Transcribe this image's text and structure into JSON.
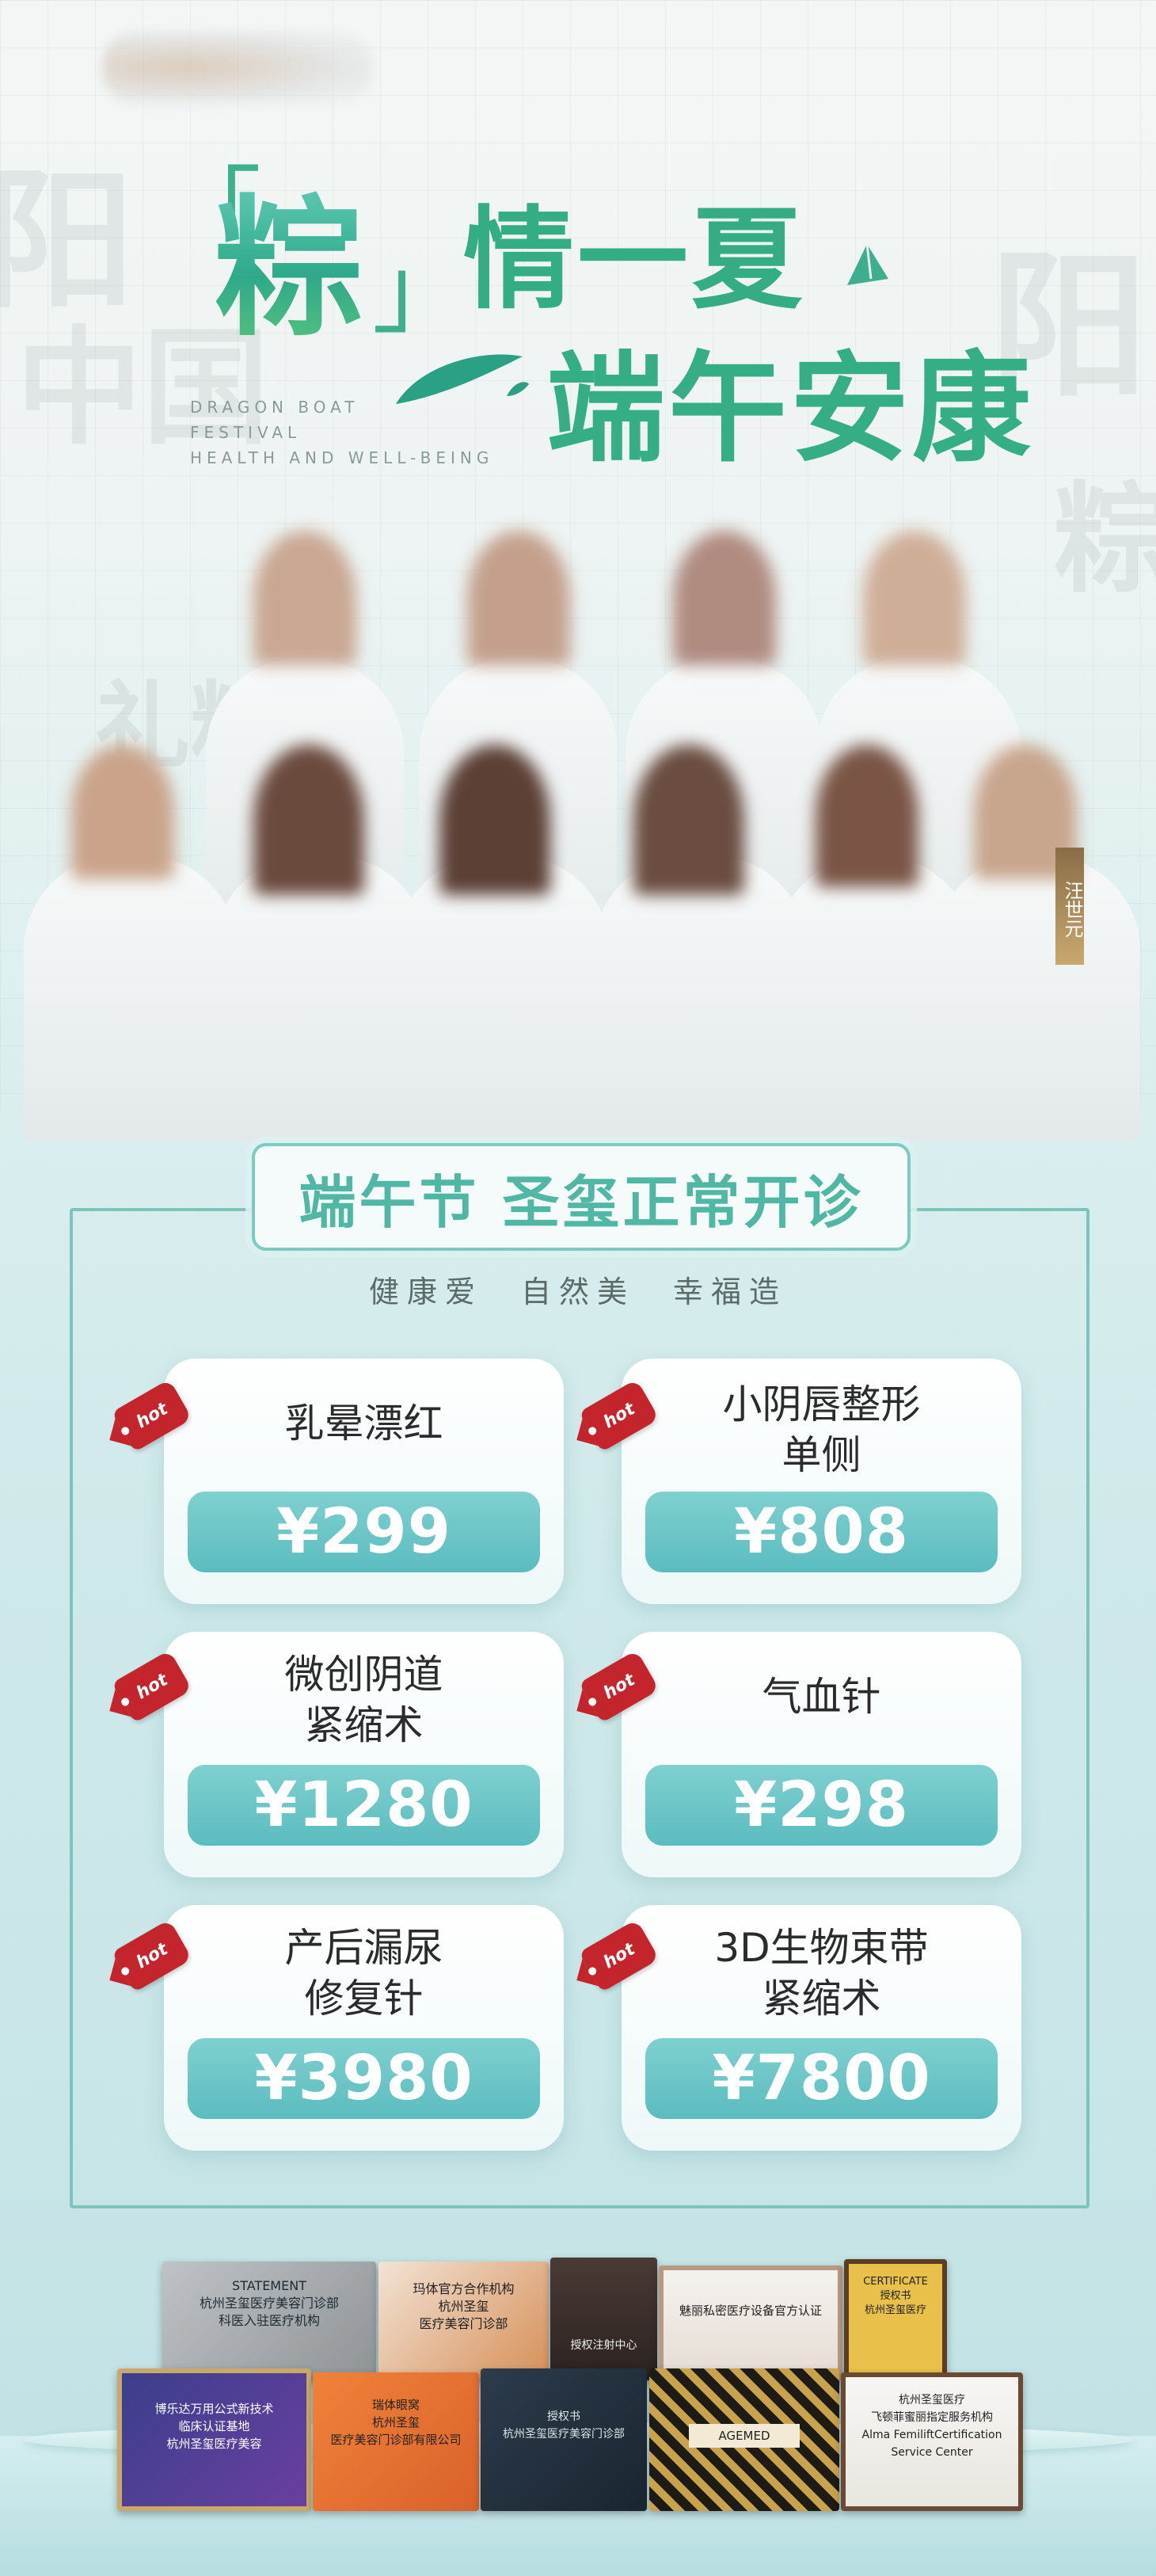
{
  "headline": {
    "bracket_left": "「",
    "zong": "粽",
    "bracket_right": "」",
    "line1_rest": "情一夏",
    "line2": "端午安康",
    "english": [
      "DRAGON BOAT",
      "FESTIVAL",
      "HEALTH AND WELL-BEING"
    ]
  },
  "team": {
    "name_plate": "汪世元"
  },
  "banner": {
    "text": "端午节 圣玺正常开诊"
  },
  "tagline": "健康爱　自然美　幸福造",
  "items": [
    {
      "name": "乳晕漂红",
      "price": "¥299",
      "badge": "hot"
    },
    {
      "name": "小阴唇整形\n单侧",
      "price": "¥808",
      "badge": "hot"
    },
    {
      "name": "微创阴道\n紧缩术",
      "price": "¥1280",
      "badge": "hot"
    },
    {
      "name": "气血针",
      "price": "¥298",
      "badge": "hot"
    },
    {
      "name": "产后漏尿\n修复针",
      "price": "¥3980",
      "badge": "hot"
    },
    {
      "name": "3D生物束带\n紧缩术",
      "price": "¥7800",
      "badge": "hot"
    }
  ],
  "certificates": [
    {
      "text": "STATEMENT\n杭州圣玺医疗美容门诊部\n科医入驻医疗机构"
    },
    {
      "text": "玛体官方合作机构\n杭州圣玺\n医疗美容门诊部"
    },
    {
      "text": "授权注射中心"
    },
    {
      "text": "魅丽私密医疗设备官方认证"
    },
    {
      "text": "CERTIFICATE\n授权书\n杭州圣玺医疗"
    },
    {
      "text": "博乐达万用公式新技术\n临床认证基地\n杭州圣玺医疗美容"
    },
    {
      "text": "瑞体眼窝\n杭州圣玺\n医疗美容门诊部有限公司"
    },
    {
      "text": "授权书\n杭州圣玺医疗美容门诊部"
    },
    {
      "text": "AGEMED"
    },
    {
      "text": "杭州圣玺医疗\n飞顿菲蜜丽指定服务机构\nAlma FemiliftCertification Service Center"
    }
  ],
  "colors": {
    "accent": "#4fb7a4",
    "price_bar": "#5bbcbf",
    "hot": "#c4242b"
  }
}
